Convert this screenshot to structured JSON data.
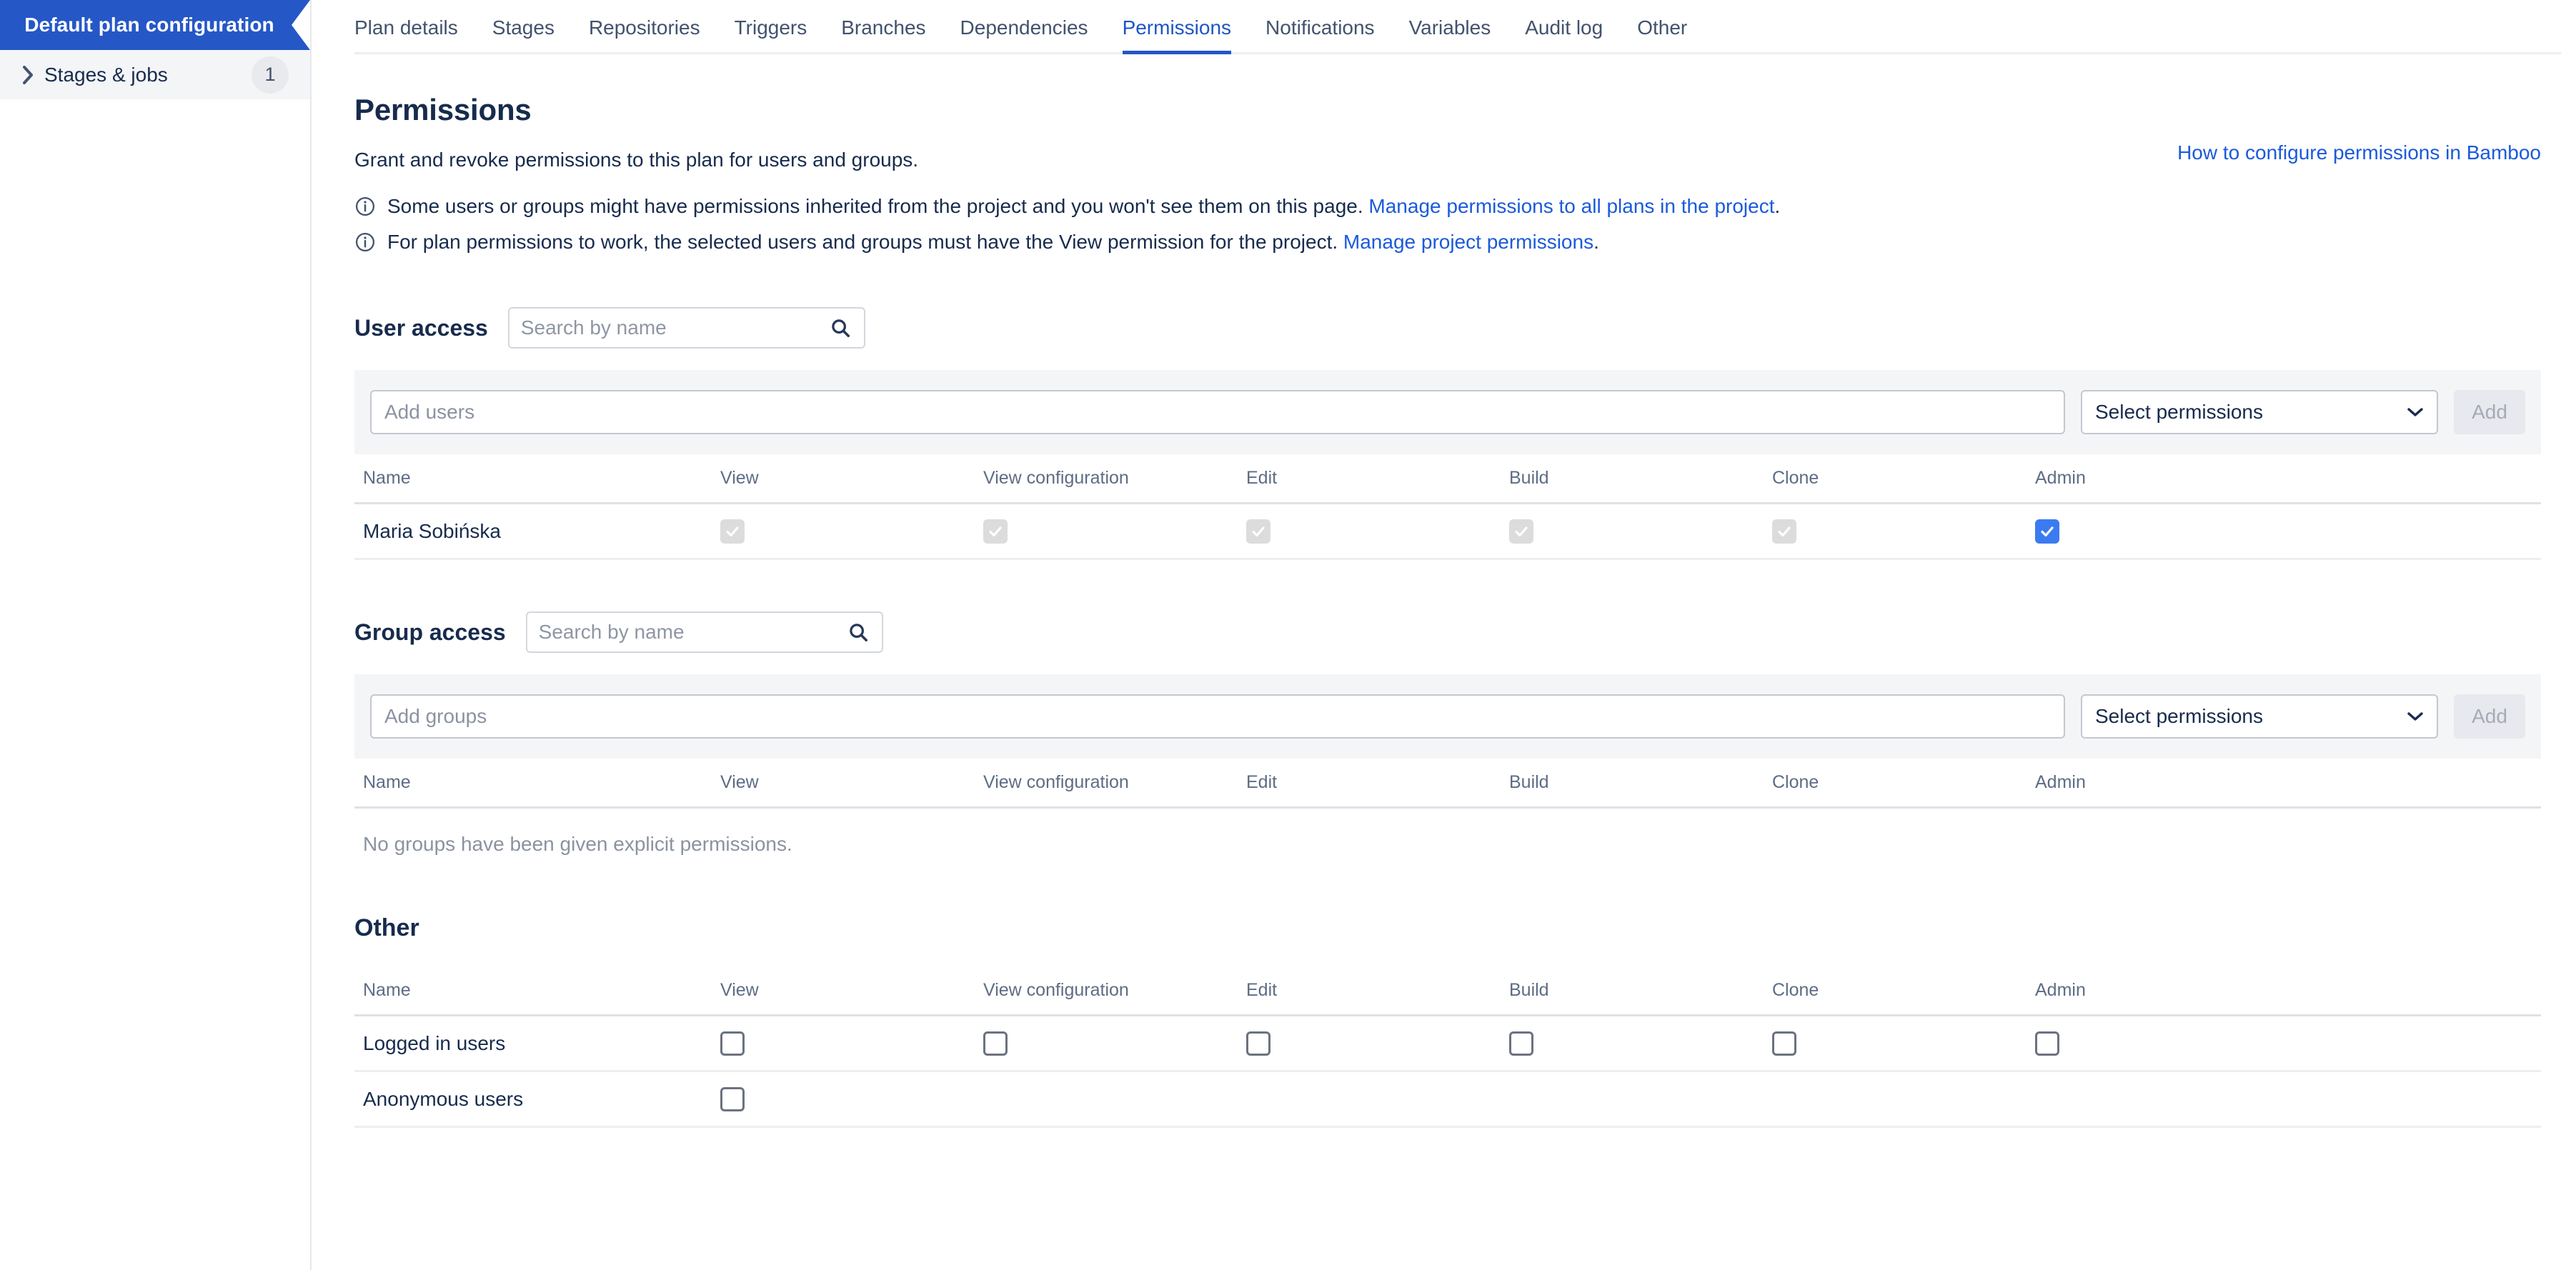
{
  "sidebar": {
    "title": "Default plan configuration",
    "items": [
      {
        "label": "Stages & jobs",
        "count": "1"
      }
    ]
  },
  "tabs": [
    {
      "label": "Plan details",
      "active": false
    },
    {
      "label": "Stages",
      "active": false
    },
    {
      "label": "Repositories",
      "active": false
    },
    {
      "label": "Triggers",
      "active": false
    },
    {
      "label": "Branches",
      "active": false
    },
    {
      "label": "Dependencies",
      "active": false
    },
    {
      "label": "Permissions",
      "active": true
    },
    {
      "label": "Notifications",
      "active": false
    },
    {
      "label": "Variables",
      "active": false
    },
    {
      "label": "Audit log",
      "active": false
    },
    {
      "label": "Other",
      "active": false
    }
  ],
  "page": {
    "title": "Permissions",
    "howto_link": "How to configure permissions in Bamboo",
    "subtitle": "Grant and revoke permissions to this plan for users and groups.",
    "notes": [
      {
        "text": "Some users or groups might have permissions inherited from the project and you won't see them on this page. ",
        "link": "Manage permissions to all plans in the project",
        "tail": "."
      },
      {
        "text": "For plan permissions to work, the selected users and groups must have the View permission for the project. ",
        "link": "Manage project permissions",
        "tail": "."
      }
    ]
  },
  "columns": [
    "Name",
    "View",
    "View configuration",
    "Edit",
    "Build",
    "Clone",
    "Admin"
  ],
  "user_access": {
    "label": "User access",
    "search_placeholder": "Search by name",
    "search_value": "",
    "add_placeholder": "Add users",
    "add_value": "",
    "select_label": "Select permissions",
    "add_button": "Add",
    "rows": [
      {
        "name": "Maria Sobińska",
        "perms": [
          "checked-disabled",
          "checked-disabled",
          "checked-disabled",
          "checked-disabled",
          "checked-disabled",
          "checked-blue"
        ]
      }
    ]
  },
  "group_access": {
    "label": "Group access",
    "search_placeholder": "Search by name",
    "search_value": "",
    "add_placeholder": "Add groups",
    "add_value": "",
    "select_label": "Select permissions",
    "add_button": "Add",
    "empty_message": "No groups have been given explicit permissions.",
    "rows": []
  },
  "other": {
    "title": "Other",
    "rows": [
      {
        "name": "Logged in users",
        "perms": [
          "empty",
          "empty",
          "empty",
          "empty",
          "empty",
          "empty"
        ]
      },
      {
        "name": "Anonymous users",
        "perms": [
          "empty",
          "none",
          "none",
          "none",
          "none",
          "none"
        ]
      }
    ]
  },
  "colors": {
    "brand_blue": "#2557c7",
    "link_blue": "#1b5ada",
    "checkbox_blue": "#3b7bf0",
    "text": "#172b4d",
    "muted": "#5e6c84"
  }
}
